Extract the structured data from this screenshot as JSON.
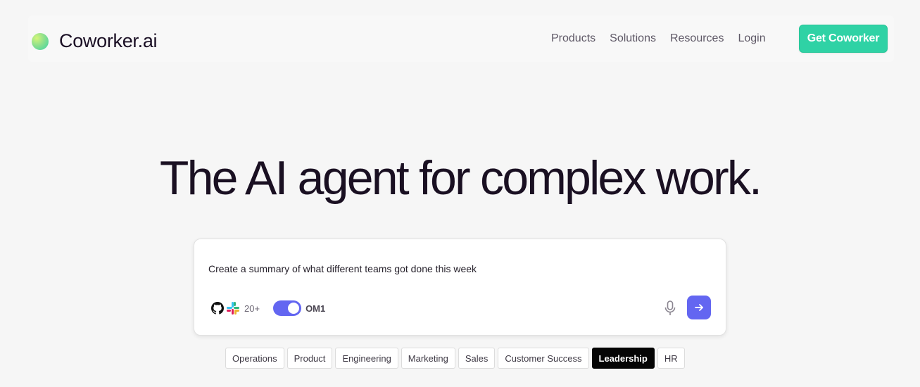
{
  "brand": {
    "name": "Coworker.ai"
  },
  "nav": {
    "links": [
      "Products",
      "Solutions",
      "Resources",
      "Login"
    ],
    "cta": "Get Coworker"
  },
  "hero": {
    "title": "The AI agent for complex work."
  },
  "prompt": {
    "text": "Create a summary of what different teams got done this week",
    "integrations_count": "20+",
    "toggle_on": true,
    "model_label": "OM1",
    "icons": [
      "github-icon",
      "slack-icon",
      "microphone-icon",
      "arrow-right-icon"
    ]
  },
  "categories": {
    "items": [
      "Operations",
      "Product",
      "Engineering",
      "Marketing",
      "Sales",
      "Customer Success",
      "Leadership",
      "HR"
    ],
    "active": "Leadership"
  },
  "colors": {
    "accent": "#2fd2a5",
    "primary": "#6366f1",
    "active_chip": "#050505",
    "text": "#1a1022"
  }
}
